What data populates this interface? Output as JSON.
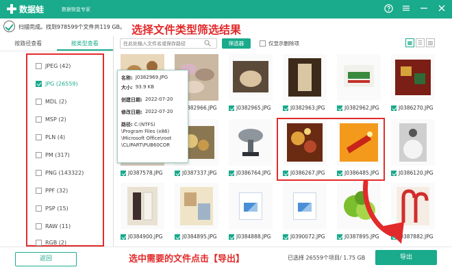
{
  "app": {
    "name": "数据蛙",
    "subtitle": "数据恢复专家"
  },
  "status": {
    "text": "扫描完成。找到978599个文件共119 GB。"
  },
  "annotations": {
    "top": "选择文件类型筛选结果",
    "bottom": "选中需要的文件点击【导出】"
  },
  "left_tabs": [
    {
      "label": "按路径查看"
    },
    {
      "label": "按类型查看"
    }
  ],
  "file_types": [
    {
      "label": "JPEG (42)",
      "checked": false
    },
    {
      "label": "JPG (26559)",
      "checked": true
    },
    {
      "label": "MDL (2)",
      "checked": false
    },
    {
      "label": "MSP (2)",
      "checked": false
    },
    {
      "label": "PLN (4)",
      "checked": false
    },
    {
      "label": "PM (317)",
      "checked": false
    },
    {
      "label": "PNG (143322)",
      "checked": false
    },
    {
      "label": "PPF (32)",
      "checked": false
    },
    {
      "label": "PSP (15)",
      "checked": false
    },
    {
      "label": "RAW (11)",
      "checked": false
    },
    {
      "label": "RGB (2)",
      "checked": false
    }
  ],
  "toolbar": {
    "search_placeholder": "在此处输入文件名或保存路径",
    "filter_label": "筛选器",
    "deleted_only_label": "仅显示删除项"
  },
  "files": [
    {
      "name": "",
      "thumb": "food"
    },
    {
      "name": "J0382966.JPG",
      "thumb": "stones"
    },
    {
      "name": "J0382965.JPG",
      "thumb": "sepia-cat"
    },
    {
      "name": "J0382963.JPG",
      "thumb": "statue"
    },
    {
      "name": "J0382962.JPG",
      "thumb": "xmas-sign"
    },
    {
      "name": "J0386270.JPG",
      "thumb": "gifts"
    },
    {
      "name": "J0387578.JPG",
      "thumb": "knight"
    },
    {
      "name": "J0387337.JPG",
      "thumb": "ornaments"
    },
    {
      "name": "J0386764.JPG",
      "thumb": "trophy"
    },
    {
      "name": "J0386267.JPG",
      "thumb": "xmas-scene"
    },
    {
      "name": "J0386485.JPG",
      "thumb": "orange-candle"
    },
    {
      "name": "J0386120.JPG",
      "thumb": "bride"
    },
    {
      "name": "J0384900.JPG",
      "thumb": "couple"
    },
    {
      "name": "J0384895.JPG",
      "thumb": "collage"
    },
    {
      "name": "J0384888.JPG",
      "thumb": "doc"
    },
    {
      "name": "J0390072.JPG",
      "thumb": "doc"
    },
    {
      "name": "J0387895.JPG",
      "thumb": "limes"
    },
    {
      "name": "J0387882.JPG",
      "thumb": "candy-canes"
    }
  ],
  "info_card": {
    "name_label": "名称:",
    "name": "J0382969.JPG",
    "size_label": "大小:",
    "size": "93.9 KB",
    "created_label": "创建日期:",
    "created": "2022-07-20",
    "modified_label": "修改日期:",
    "modified": "2022-07-20",
    "path_label": "路径:",
    "path_1": "C:(NTFS)",
    "path_2": "\\Program Files (x86)",
    "path_3": "\\Microsoft Office\\root",
    "path_4": "\\CLIPART\\PUB60COR"
  },
  "bottom": {
    "back_label": "返回",
    "selection_info": "已选择 26559个项目/ 1.75 GB",
    "export_label": "导出"
  },
  "colors": {
    "accent": "#1aaa8c",
    "annotation": "#e32a2a"
  }
}
